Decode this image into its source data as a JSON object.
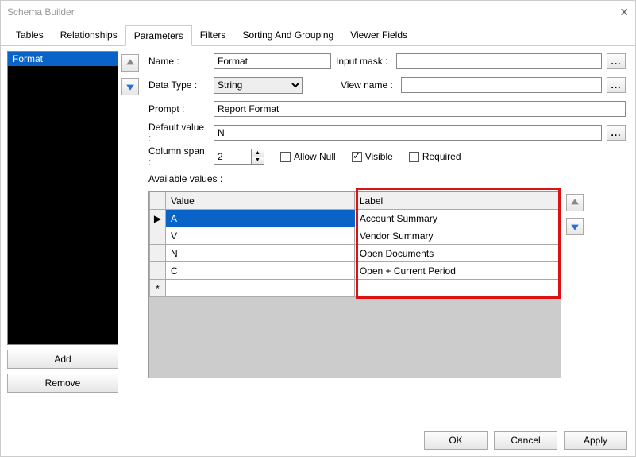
{
  "window": {
    "title": "Schema Builder"
  },
  "tabs": [
    "Tables",
    "Relationships",
    "Parameters",
    "Filters",
    "Sorting And Grouping",
    "Viewer Fields"
  ],
  "active_tab": "Parameters",
  "left": {
    "items": [
      "Format"
    ],
    "add": "Add",
    "remove": "Remove"
  },
  "form": {
    "name_lbl": "Name :",
    "name_val": "Format",
    "input_mask_lbl": "Input mask :",
    "input_mask_val": "",
    "datatype_lbl": "Data Type :",
    "datatype_val": "String",
    "viewname_lbl": "View name :",
    "viewname_val": "",
    "prompt_lbl": "Prompt :",
    "prompt_val": "Report Format",
    "default_lbl": "Default value :",
    "default_val": "N",
    "colspan_lbl": "Column span :",
    "colspan_val": "2",
    "allow_null": "Allow Null",
    "visible": "Visible",
    "required": "Required",
    "avail_lbl": "Available values :",
    "ellipsis": "..."
  },
  "grid": {
    "col_value": "Value",
    "col_label": "Label",
    "rows": [
      {
        "value": "A",
        "label": "Account Summary"
      },
      {
        "value": "V",
        "label": "Vendor Summary"
      },
      {
        "value": "N",
        "label": "Open Documents"
      },
      {
        "value": "C",
        "label": "Open + Current Period"
      }
    ],
    "new_row_marker": "*",
    "sel_marker": "▶"
  },
  "footer": {
    "ok": "OK",
    "cancel": "Cancel",
    "apply": "Apply"
  }
}
